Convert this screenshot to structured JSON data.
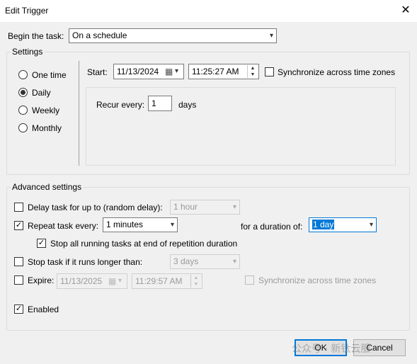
{
  "window": {
    "title": "Edit Trigger",
    "close_glyph": "✕"
  },
  "begin": {
    "label": "Begin the task:",
    "value": "On a schedule"
  },
  "settings": {
    "title": "Settings",
    "schedule_options": [
      {
        "label": "One time",
        "checked": false
      },
      {
        "label": "Daily",
        "checked": true
      },
      {
        "label": "Weekly",
        "checked": false
      },
      {
        "label": "Monthly",
        "checked": false
      }
    ],
    "start_label": "Start:",
    "start_date": "11/13/2024",
    "start_time": "11:25:27 AM",
    "sync_label": "Synchronize across time zones",
    "recur_label": "Recur every:",
    "recur_value": "1",
    "recur_unit": "days"
  },
  "advanced": {
    "title": "Advanced settings",
    "delay": {
      "label": "Delay task for up to (random delay):",
      "value": "1 hour",
      "checked": false
    },
    "repeat": {
      "label": "Repeat task every:",
      "value": "1 minutes",
      "checked": true
    },
    "duration": {
      "label": "for a duration of:",
      "value": "1 day"
    },
    "stop_running": {
      "label": "Stop all running tasks at end of repetition duration",
      "checked": true
    },
    "stop_longer": {
      "label": "Stop task if it runs longer than:",
      "value": "3 days",
      "checked": false
    },
    "expire": {
      "label": "Expire:",
      "date": "11/13/2025",
      "time": "11:29:57 AM",
      "sync_label": "Synchronize across time zones",
      "checked": false
    },
    "enabled": {
      "label": "Enabled",
      "checked": true
    }
  },
  "buttons": {
    "ok": "OK",
    "cancel": "Cancel"
  },
  "watermark": "公众号 · 新钛云服"
}
